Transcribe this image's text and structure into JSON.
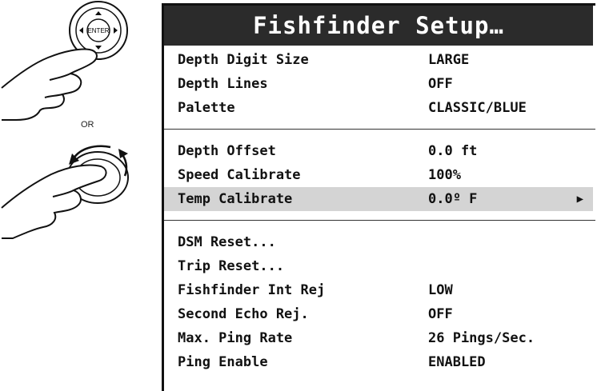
{
  "illustration": {
    "knob_label": "ENTER",
    "or_label": "OR"
  },
  "menu": {
    "title": "Fishfinder Setup…",
    "group1": [
      {
        "label": "Depth Digit Size",
        "value": "LARGE"
      },
      {
        "label": "Depth Lines",
        "value": "OFF"
      },
      {
        "label": "Palette",
        "value": "CLASSIC/BLUE"
      }
    ],
    "group2": [
      {
        "label": "Depth Offset",
        "value": "0.0 ft"
      },
      {
        "label": "Speed Calibrate",
        "value": "100%"
      },
      {
        "label": "Temp Calibrate",
        "value": "0.0º F",
        "selected": true,
        "arrow": "▶"
      }
    ],
    "group3": [
      {
        "label": "DSM Reset...",
        "value": ""
      },
      {
        "label": "Trip Reset...",
        "value": ""
      },
      {
        "label": "Fishfinder Int Rej",
        "value": "LOW"
      },
      {
        "label": "Second Echo Rej.",
        "value": "OFF"
      },
      {
        "label": "Max. Ping Rate",
        "value": "26 Pings/Sec."
      },
      {
        "label": "Ping Enable",
        "value": "ENABLED"
      }
    ]
  }
}
